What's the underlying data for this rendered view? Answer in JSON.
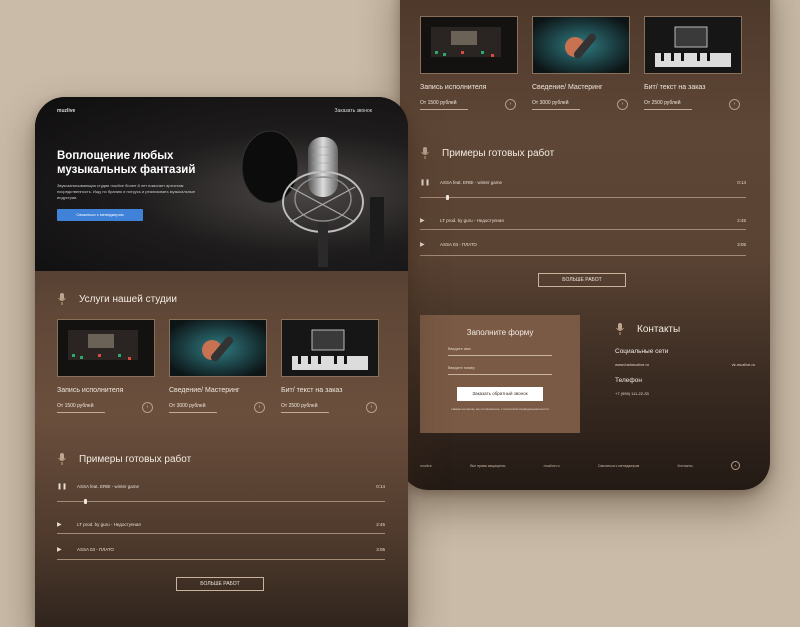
{
  "brand": "muzlive",
  "nav": {
    "cta": "Заказать звонок"
  },
  "hero": {
    "title": "Воплощение любых музыкальных фантазий",
    "description": "Звукозаписывающая студия muzlive более 8 лет помогает артистам посредственность. Ищу по бранию и потрусь и реализовать музыкальные индустрии.",
    "button": "Связаться с менеджером"
  },
  "services": {
    "title": "Услуги нашей студии",
    "items": [
      {
        "name": "Запись исполнителя",
        "price": "От 1500 рублей"
      },
      {
        "name": "Сведение/ Мастеринг",
        "price": "От 3000 рублей"
      },
      {
        "name": "Бит/ текст на заказ",
        "price": "От 2500 рублей"
      }
    ]
  },
  "works": {
    "title": "Примеры готовых работ",
    "tracks": [
      {
        "name": "ASSA feat. ERBI - winter game",
        "duration": "0:14",
        "state": "pause",
        "progress": 0.08
      },
      {
        "name": "LT prod. by guru - Недоступная",
        "duration": "2:45",
        "state": "play"
      },
      {
        "name": "ASSA 03 - ПЛАТО",
        "duration": "3:05",
        "state": "play"
      }
    ],
    "more_button": "БОЛЬШЕ РАБОТ"
  },
  "form": {
    "title": "Заполните форму",
    "name_placeholder": "Введите имя",
    "phone_placeholder": "Введите номер",
    "submit": "Заказать обратный звонок",
    "consent": "Нажав на кнопку, вы соглашаетесь с политикой конфиденциальности"
  },
  "contacts": {
    "title": "Контакты",
    "social_title": "Социальные сети",
    "social_1": "www.instmuzlive.ru",
    "social_2": "vk.muzlive.ru",
    "phone_title": "Телефон",
    "phone": "+7 (999) 111-22-33"
  },
  "footer": {
    "brand": "muzlive",
    "rights": "Все права защищены",
    "email": "muzlive.ru",
    "manager": "Связаться с менеджером",
    "contacts": "Контакты"
  },
  "colors": {
    "accent": "#3f82d8",
    "card": "#6b4f3d",
    "form": "#7a5a45",
    "background": "#c9bba8"
  }
}
